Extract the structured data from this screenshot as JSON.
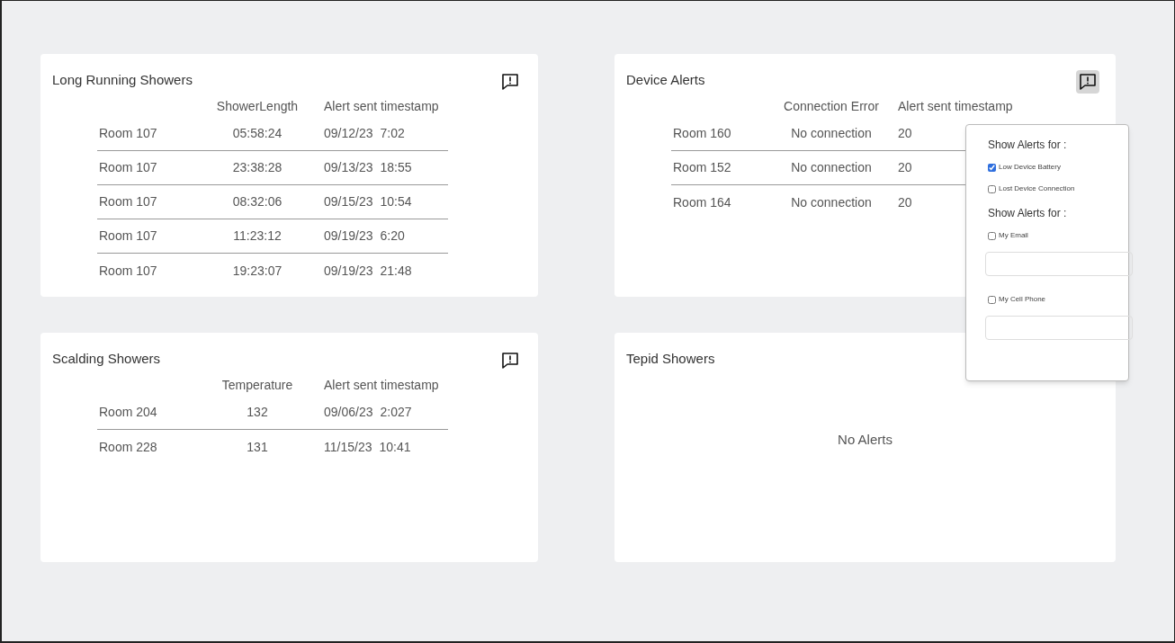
{
  "panels": [
    {
      "kind": "table",
      "title": "Long Running Showers",
      "alert_button_active": false,
      "columns": [
        "ShowerLength",
        "Alert sent timestamp"
      ],
      "rows": [
        {
          "room": "Room 107",
          "value": "05:58:24",
          "date": "09/12/23",
          "time": "7:02"
        },
        {
          "room": "Room 107",
          "value": "23:38:28",
          "date": "09/13/23",
          "time": "18:55"
        },
        {
          "room": "Room 107",
          "value": "08:32:06",
          "date": "09/15/23",
          "time": "10:54"
        },
        {
          "room": "Room 107",
          "value": "11:23:12",
          "date": "09/19/23",
          "time": "6:20"
        },
        {
          "room": "Room 107",
          "value": "19:23:07",
          "date": "09/19/23",
          "time": "21:48"
        }
      ]
    },
    {
      "kind": "table",
      "title": "Device Alerts",
      "alert_button_active": true,
      "columns": [
        "Connection Error",
        "Alert sent timestamp"
      ],
      "rows": [
        {
          "room": "Room 160",
          "value": "No connection",
          "date": "20"
        },
        {
          "room": "Room 152",
          "value": "No connection",
          "date": "20"
        },
        {
          "room": "Room 164",
          "value": "No connection",
          "date": "20"
        }
      ]
    },
    {
      "kind": "table",
      "title": "Scalding Showers",
      "alert_button_active": false,
      "columns": [
        "Temperature",
        "Alert sent timestamp"
      ],
      "rows": [
        {
          "room": "Room 204",
          "value": "132",
          "date": "09/06/23",
          "time": "2:027"
        },
        {
          "room": "Room 228",
          "value": "131",
          "date": "11/15/23",
          "time": "10:41"
        }
      ]
    },
    {
      "kind": "empty",
      "title": "Tepid Showers",
      "message": "No Alerts"
    }
  ],
  "popup": {
    "sections": [
      {
        "heading": "Show Alerts for :",
        "options": [
          {
            "kind": "checkbox",
            "label": "Low Device Battery",
            "checked": true
          },
          {
            "kind": "checkbox",
            "label": "Lost Device Connection",
            "checked": false
          }
        ]
      },
      {
        "heading": "Show Alerts for :",
        "options": [
          {
            "kind": "checkbox",
            "label": "My Email",
            "checked": false
          },
          {
            "kind": "field"
          },
          {
            "kind": "checkbox",
            "label": "My Cell Phone",
            "checked": false
          },
          {
            "kind": "field"
          }
        ]
      }
    ]
  }
}
